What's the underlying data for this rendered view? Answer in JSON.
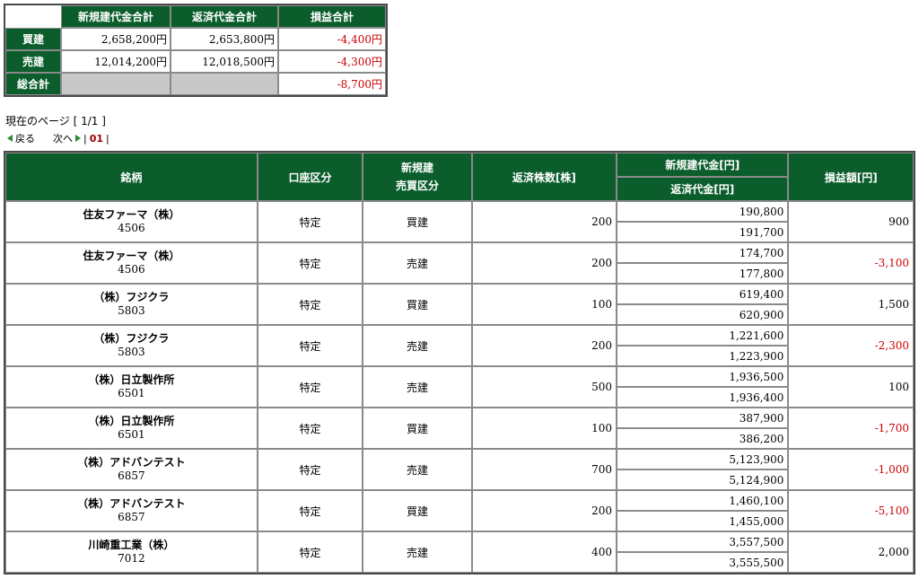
{
  "summary": {
    "headers": [
      "新規建代金合計",
      "返済代金合計",
      "損益合計"
    ],
    "rows": [
      {
        "label": "買建",
        "new_total": "2,658,200円",
        "close_total": "2,653,800円",
        "pl": "-4,400円"
      },
      {
        "label": "売建",
        "new_total": "12,014,200円",
        "close_total": "12,018,500円",
        "pl": "-4,300円"
      }
    ],
    "grand": {
      "label": "総合計",
      "pl": "-8,700円"
    }
  },
  "pagination": {
    "current_page": "現在のページ [ 1/1 ]",
    "prev": "戻る",
    "next": "次へ",
    "sep_left": "|",
    "page": "01",
    "sep_right": "|"
  },
  "table": {
    "headers": {
      "name": "銘柄",
      "account": "口座区分",
      "side_line1": "新規建",
      "side_line2": "売買区分",
      "qty": "返済株数[株]",
      "new_amount": "新規建代金[円]",
      "close_amount": "返済代金[円]",
      "pl": "損益額[円]"
    },
    "rows": [
      {
        "name": "住友ファーマ（株）",
        "code": "4506",
        "account": "特定",
        "side": "買建",
        "qty": "200",
        "new_amount": "190,800",
        "close_amount": "191,700",
        "pl": "900"
      },
      {
        "name": "住友ファーマ（株）",
        "code": "4506",
        "account": "特定",
        "side": "売建",
        "qty": "200",
        "new_amount": "174,700",
        "close_amount": "177,800",
        "pl": "-3,100"
      },
      {
        "name": "（株）フジクラ",
        "code": "5803",
        "account": "特定",
        "side": "買建",
        "qty": "100",
        "new_amount": "619,400",
        "close_amount": "620,900",
        "pl": "1,500"
      },
      {
        "name": "（株）フジクラ",
        "code": "5803",
        "account": "特定",
        "side": "売建",
        "qty": "200",
        "new_amount": "1,221,600",
        "close_amount": "1,223,900",
        "pl": "-2,300"
      },
      {
        "name": "（株）日立製作所",
        "code": "6501",
        "account": "特定",
        "side": "売建",
        "qty": "500",
        "new_amount": "1,936,500",
        "close_amount": "1,936,400",
        "pl": "100"
      },
      {
        "name": "（株）日立製作所",
        "code": "6501",
        "account": "特定",
        "side": "買建",
        "qty": "100",
        "new_amount": "387,900",
        "close_amount": "386,200",
        "pl": "-1,700"
      },
      {
        "name": "（株）アドバンテスト",
        "code": "6857",
        "account": "特定",
        "side": "売建",
        "qty": "700",
        "new_amount": "5,123,900",
        "close_amount": "5,124,900",
        "pl": "-1,000"
      },
      {
        "name": "（株）アドバンテスト",
        "code": "6857",
        "account": "特定",
        "side": "買建",
        "qty": "200",
        "new_amount": "1,460,100",
        "close_amount": "1,455,000",
        "pl": "-5,100"
      },
      {
        "name": "川崎重工業（株）",
        "code": "7012",
        "account": "特定",
        "side": "売建",
        "qty": "400",
        "new_amount": "3,557,500",
        "close_amount": "3,555,500",
        "pl": "2,000"
      }
    ]
  },
  "colors": {
    "header_green": "#0b5e2c",
    "negative_red": "#cc0000",
    "blank_gray": "#c8c8c8"
  }
}
